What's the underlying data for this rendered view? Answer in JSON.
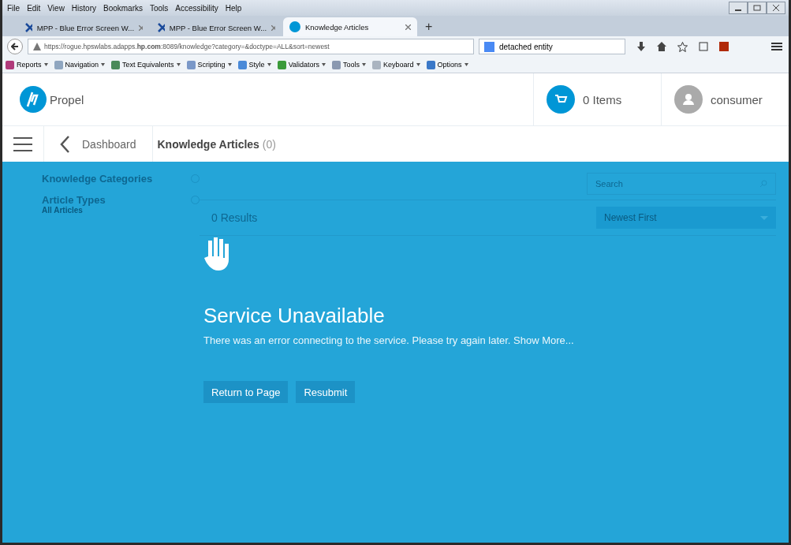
{
  "menu_bar": [
    "File",
    "Edit",
    "View",
    "History",
    "Bookmarks",
    "Tools",
    "Accessibility",
    "Help"
  ],
  "tabs": [
    {
      "title": "MPP - Blue Error Screen W...",
      "selected": false,
      "kind": "tool"
    },
    {
      "title": "MPP - Blue Error Screen W...",
      "selected": false,
      "kind": "tool"
    },
    {
      "title": "Knowledge Articles",
      "selected": true,
      "kind": "hp"
    }
  ],
  "new_tab": "+",
  "address": {
    "url": "https://rogue.hpswlabs.adapps.**hp.com**:8089/knowledge?category=&doctype=ALL&sort=newest"
  },
  "browser_search": {
    "value": "detached entity"
  },
  "bookmarks": [
    "Reports",
    "Navigation",
    "Text Equivalents",
    "Scripting",
    "Style",
    "Validators",
    "Tools",
    "Keyboard",
    "Options"
  ],
  "app_header": {
    "brand": "Propel",
    "cart": "0 Items",
    "user": "consumer"
  },
  "nav": {
    "back": "Dashboard",
    "title": "Knowledge Articles",
    "count": "(0)"
  },
  "sidebar": {
    "sections": [
      {
        "title": "Knowledge Categories"
      },
      {
        "title": "Article Types"
      }
    ],
    "selected_type": "All Articles"
  },
  "results": {
    "count": "0 Results",
    "search_placeholder": "Search",
    "sort": "Newest First"
  },
  "error": {
    "title": "Service Unavailable",
    "message": "There was an error connecting to the service. Please try again later. Show More...",
    "buttons": [
      "Return to Page",
      "Resubmit"
    ]
  }
}
